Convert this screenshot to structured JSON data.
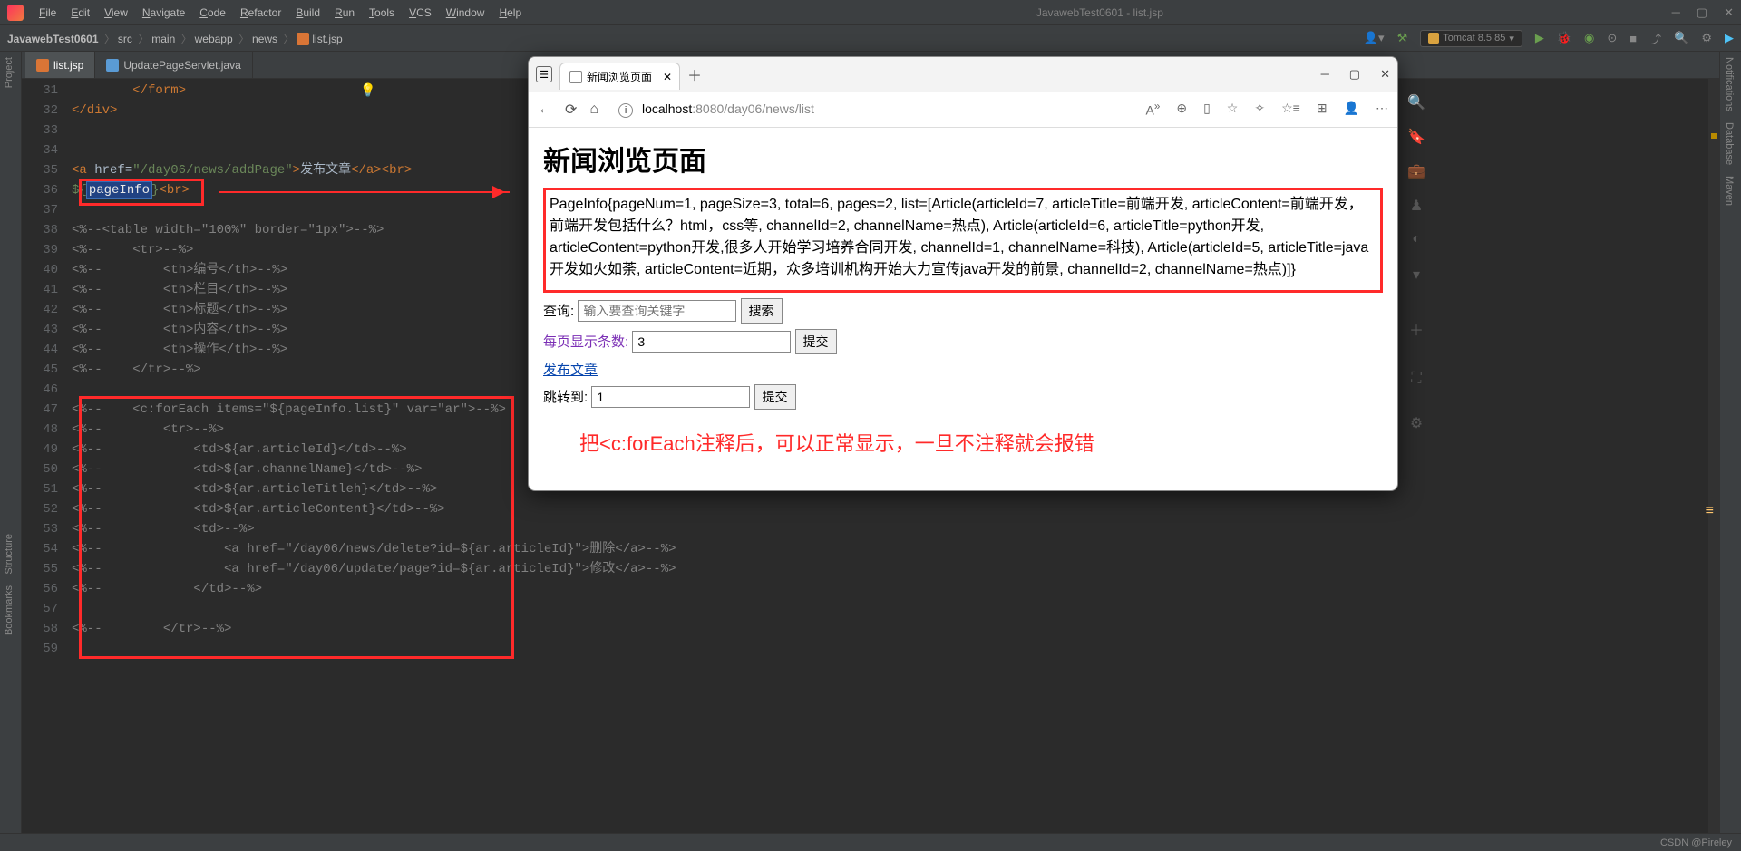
{
  "titlebar": {
    "menus": [
      "File",
      "Edit",
      "View",
      "Navigate",
      "Code",
      "Refactor",
      "Build",
      "Run",
      "Tools",
      "VCS",
      "Window",
      "Help"
    ],
    "title": "JavawebTest0601 - list.jsp"
  },
  "breadcrumb": {
    "project": "JavawebTest0601",
    "parts": [
      "src",
      "main",
      "webapp",
      "news"
    ],
    "file": "list.jsp",
    "run_config": "Tomcat 8.5.85"
  },
  "tabs": [
    {
      "label": "list.jsp",
      "active": true
    },
    {
      "label": "UpdatePageServlet.java",
      "active": false
    }
  ],
  "left_tools": [
    "Project",
    "Structure",
    "Bookmarks"
  ],
  "right_tools": [
    "Notifications",
    "Database",
    "Maven"
  ],
  "editor": {
    "lines": [
      {
        "n": 31,
        "html": "        <span class='tk-orange'>&lt;/form&gt;</span>"
      },
      {
        "n": 32,
        "html": "<span class='tk-orange'>&lt;/div&gt;</span>"
      },
      {
        "n": 33,
        "html": ""
      },
      {
        "n": 34,
        "html": ""
      },
      {
        "n": 35,
        "html": "<span class='tk-orange'>&lt;a </span><span class='tk-text'>href=</span><span class='tk-green'>\"/day06/news/addPage\"</span><span class='tk-orange'>&gt;</span><span class='tk-text'>发布文章</span><span class='tk-orange'>&lt;/a&gt;&lt;br&gt;</span>"
      },
      {
        "n": 36,
        "html": "<span class='tk-green'>${</span><span class='highlight-box tk-white'>pageInfo</span><span class='tk-green'>}</span><span class='tk-orange'>&lt;br&gt;</span>"
      },
      {
        "n": 37,
        "html": ""
      },
      {
        "n": 38,
        "html": "<span class='tk-gray'>&lt;%--&lt;table width=\"100%\" border=\"1px\"&gt;--%&gt;</span>"
      },
      {
        "n": 39,
        "html": "<span class='tk-gray'>&lt;%--    &lt;tr&gt;--%&gt;</span>"
      },
      {
        "n": 40,
        "html": "<span class='tk-gray'>&lt;%--        &lt;th&gt;编号&lt;/th&gt;--%&gt;</span>"
      },
      {
        "n": 41,
        "html": "<span class='tk-gray'>&lt;%--        &lt;th&gt;栏目&lt;/th&gt;--%&gt;</span>"
      },
      {
        "n": 42,
        "html": "<span class='tk-gray'>&lt;%--        &lt;th&gt;标题&lt;/th&gt;--%&gt;</span>"
      },
      {
        "n": 43,
        "html": "<span class='tk-gray'>&lt;%--        &lt;th&gt;内容&lt;/th&gt;--%&gt;</span>"
      },
      {
        "n": 44,
        "html": "<span class='tk-gray'>&lt;%--        &lt;th&gt;操作&lt;/th&gt;--%&gt;</span>"
      },
      {
        "n": 45,
        "html": "<span class='tk-gray'>&lt;%--    &lt;/tr&gt;--%&gt;</span>"
      },
      {
        "n": 46,
        "html": ""
      },
      {
        "n": 47,
        "html": "<span class='tk-gray'>&lt;%--    &lt;c:forEach items=\"${pageInfo.list}\" var=\"ar\"&gt;--%&gt;</span>"
      },
      {
        "n": 48,
        "html": "<span class='tk-gray'>&lt;%--        &lt;tr&gt;--%&gt;</span>"
      },
      {
        "n": 49,
        "html": "<span class='tk-gray'>&lt;%--            &lt;td&gt;${ar.articleId}&lt;/td&gt;--%&gt;</span>"
      },
      {
        "n": 50,
        "html": "<span class='tk-gray'>&lt;%--            &lt;td&gt;${ar.channelName}&lt;/td&gt;--%&gt;</span>"
      },
      {
        "n": 51,
        "html": "<span class='tk-gray'>&lt;%--            &lt;td&gt;${ar.articleTitleh}&lt;/td&gt;--%&gt;</span>"
      },
      {
        "n": 52,
        "html": "<span class='tk-gray'>&lt;%--            &lt;td&gt;${ar.articleContent}&lt;/td&gt;--%&gt;</span>"
      },
      {
        "n": 53,
        "html": "<span class='tk-gray'>&lt;%--            &lt;td&gt;--%&gt;</span>"
      },
      {
        "n": 54,
        "html": "<span class='tk-gray'>&lt;%--                &lt;a href=\"/day06/news/delete?id=${ar.articleId}\"&gt;删除&lt;/a&gt;--%&gt;</span>"
      },
      {
        "n": 55,
        "html": "<span class='tk-gray'>&lt;%--                &lt;a href=\"/day06/update/page?id=${ar.articleId}\"&gt;修改&lt;/a&gt;--%&gt;</span>"
      },
      {
        "n": 56,
        "html": "<span class='tk-gray'>&lt;%--            &lt;/td&gt;--%&gt;</span>"
      },
      {
        "n": 57,
        "html": ""
      },
      {
        "n": 58,
        "html": "<span class='tk-gray'>&lt;%--        &lt;/tr&gt;--%&gt;</span>"
      },
      {
        "n": 59,
        "html": ""
      }
    ]
  },
  "browser": {
    "tab_title": "新闻浏览页面",
    "url_host": "localhost",
    "url_port": ":8080",
    "url_path": "/day06/news/list",
    "heading": "新闻浏览页面",
    "pageinfo_text": "PageInfo{pageNum=1, pageSize=3, total=6, pages=2, list=[Article(articleId=7, articleTitle=前端开发, articleContent=前端开发，前端开发包括什么？html，css等, channelId=2, channelName=热点), Article(articleId=6, articleTitle=python开发, articleContent=python开发,很多人开始学习培养合同开发, channelId=1, channelName=科技), Article(articleId=5, articleTitle=java开发如火如荼, articleContent=近期，众多培训机构开始大力宣传java开发的前景, channelId=2, channelName=热点)]}",
    "query_label": "查询:",
    "query_placeholder": "输入要查询关键字",
    "search_btn": "搜索",
    "perpage_label": "每页显示条数:",
    "perpage_value": "3",
    "submit_btn": "提交",
    "publish_link": "发布文章",
    "jump_label": "跳转到:",
    "jump_value": "1"
  },
  "annotation": "把<c:forEach注释后，可以正常显示，一旦不注释就会报错",
  "status": "CSDN @Pireley"
}
